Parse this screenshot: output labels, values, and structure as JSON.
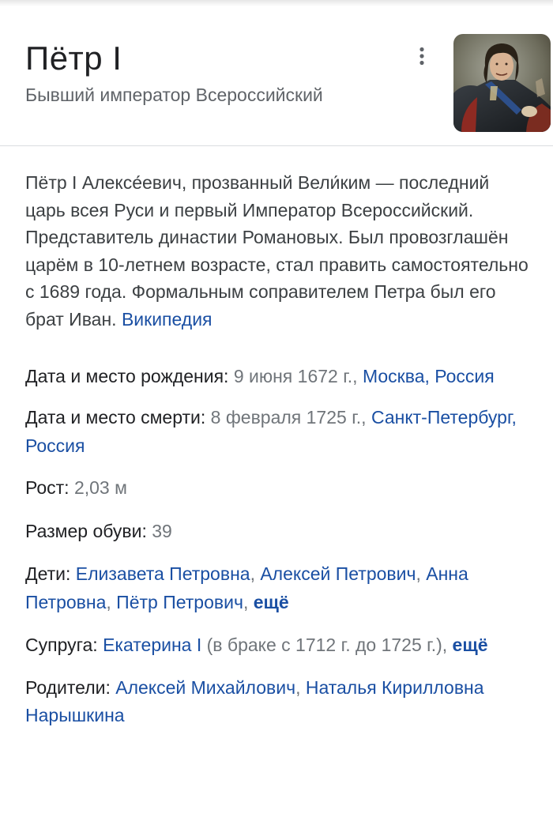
{
  "header": {
    "title": "Пётр I",
    "subtitle": "Бывший император Всероссийский"
  },
  "icons": {
    "more": "more-vert-icon",
    "portrait": "portrait-image"
  },
  "description": {
    "text": "Пётр I Алексе́евич, прозванный Вели́ким — последний царь всея Руси и первый Император Всероссийский. Представитель династии Романовых. Был провозглашён царём в 10-летнем возрасте, стал править самостоятельно с 1689 года. Формальным соправителем Петра был его брат Иван. ",
    "source_link": "Википедия"
  },
  "facts": {
    "birth": {
      "label": "Дата и место рождения: ",
      "value": "9 июня 1672 г., ",
      "link": "Москва, Россия"
    },
    "death": {
      "label": "Дата и место смерти: ",
      "value": "8 февраля 1725 г., ",
      "link": "Санкт-Петербург, Россия"
    },
    "height": {
      "label": "Рост: ",
      "value": "2,03 м"
    },
    "shoe": {
      "label": "Размер обуви: ",
      "value": "39"
    },
    "children": {
      "label": "Дети: ",
      "links": [
        "Елизавета Петровна",
        "Алексей Петрович",
        "Анна Петровна",
        "Пётр Петрович"
      ],
      "sep": ", ",
      "more": "ещё"
    },
    "spouse": {
      "label": "Супруга: ",
      "link": "Екатерина I",
      "value": " (в браке с 1712 г. до 1725 г.), ",
      "more": "ещё"
    },
    "parents": {
      "label": "Родители: ",
      "links": [
        "Алексей Михайлович",
        "Наталья Кирилловна Нарышкина"
      ],
      "sep": ", "
    }
  },
  "colors": {
    "link": "#1a4fa3",
    "text": "#202124",
    "secondary": "#70757a"
  }
}
